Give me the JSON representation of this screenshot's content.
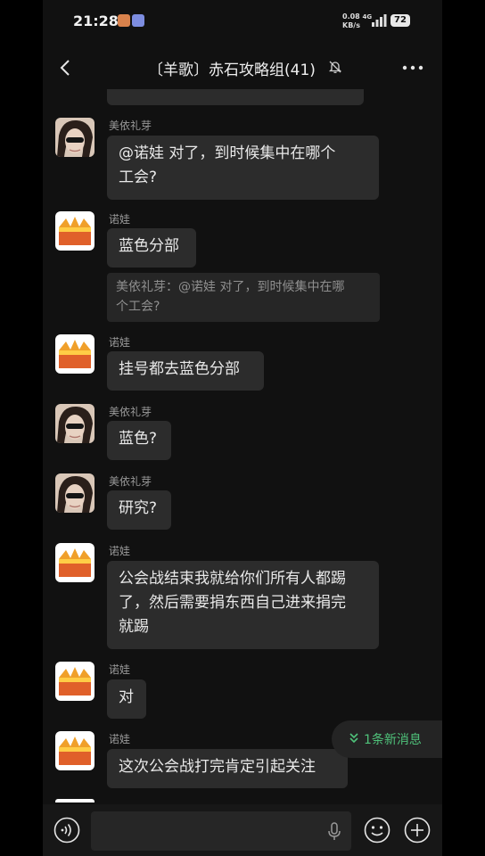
{
  "status_bar": {
    "time": "21:28",
    "network_speed": "0.08",
    "network_unit": "KB/s",
    "network_type": "4G",
    "battery": "72"
  },
  "header": {
    "title": "〔羊歌〕赤石攻略组(41)",
    "back_icon": "chevron-left-icon",
    "mute_icon": "bell-off-icon",
    "more_icon": "more-dots-icon"
  },
  "messages": [
    {
      "sender": "美依礼芽",
      "avatar": "person-avatar",
      "text_lines": [
        "@诺娃  对了，到时候集中在哪个",
        "工会?"
      ]
    },
    {
      "sender": "诺娃",
      "avatar": "crown-avatar",
      "text_lines": [
        "蓝色分部"
      ],
      "quote_lines": [
        "美依礼芽：@诺娃 对了，到时候集中在哪",
        "个工会?"
      ]
    },
    {
      "sender": "诺娃",
      "avatar": "crown-avatar",
      "text_lines": [
        "挂号都去蓝色分部"
      ]
    },
    {
      "sender": "美依礼芽",
      "avatar": "person-avatar",
      "text_lines": [
        "蓝色?"
      ]
    },
    {
      "sender": "美依礼芽",
      "avatar": "person-avatar",
      "text_lines": [
        "研究?"
      ]
    },
    {
      "sender": "诺娃",
      "avatar": "crown-avatar",
      "text_lines": [
        "公会战结束我就给你们所有人都踢",
        "了，然后需要捐东西自己进来捐完",
        "就踢"
      ]
    },
    {
      "sender": "诺娃",
      "avatar": "crown-avatar",
      "text_lines": [
        "对"
      ]
    },
    {
      "sender": "诺娃",
      "avatar": "crown-avatar",
      "text_lines": [
        "这次公会战打完肯定引起关注"
      ]
    }
  ],
  "new_messages": {
    "label": "1条新消息",
    "icon": "double-chevron-down-icon"
  },
  "input_bar": {
    "voice_icon": "voice-icon",
    "mic_icon": "mic-icon",
    "emoji_icon": "emoji-icon",
    "plus_icon": "plus-icon"
  },
  "colors": {
    "accent_green": "#4fc27a",
    "bubble": "#2c2c2c",
    "background": "#111111"
  }
}
